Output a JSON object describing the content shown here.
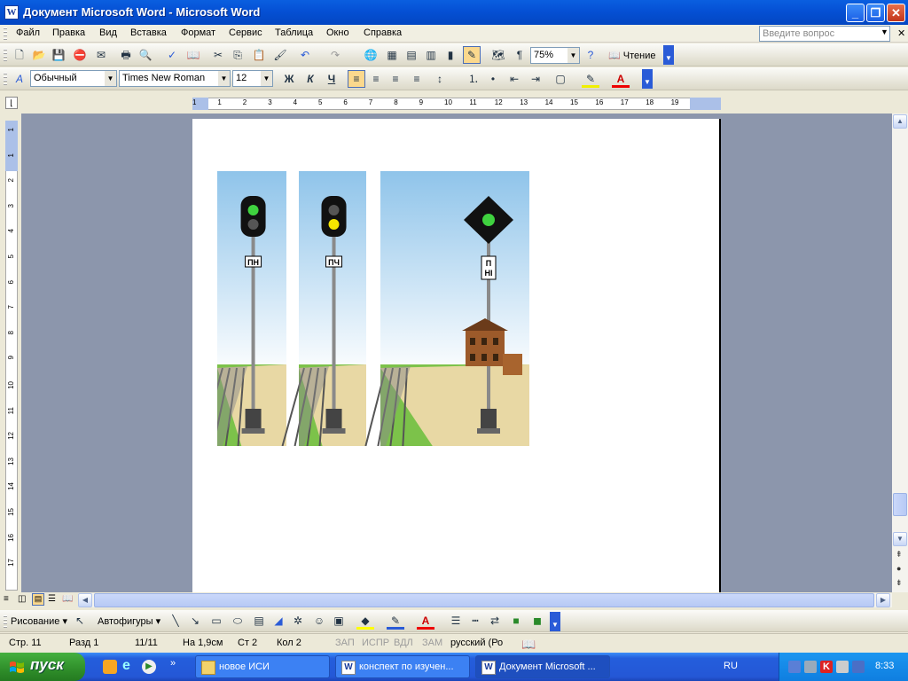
{
  "window": {
    "title": "Документ Microsoft Word - Microsoft Word",
    "icon": "word-icon"
  },
  "menu": {
    "items": [
      "Файл",
      "Правка",
      "Вид",
      "Вставка",
      "Формат",
      "Сервис",
      "Таблица",
      "Окно",
      "Справка"
    ],
    "ask_placeholder": "Введите вопрос"
  },
  "standard_toolbar": {
    "zoom": "75%",
    "reading_label": "Чтение"
  },
  "format_toolbar": {
    "style": "Обычный",
    "font": "Times New Roman",
    "size": "12",
    "bold": "Ж",
    "italic": "К",
    "underline": "Ч"
  },
  "ruler": {
    "h_numbers": [
      "1",
      "1",
      "2",
      "3",
      "4",
      "5",
      "6",
      "7",
      "8",
      "9",
      "10",
      "11",
      "12",
      "13",
      "14",
      "15",
      "16",
      "17",
      "18",
      "19"
    ],
    "v_numbers": [
      "1",
      "1",
      "2",
      "3",
      "4",
      "5",
      "6",
      "7",
      "8",
      "9",
      "10",
      "11",
      "12",
      "13",
      "14",
      "15",
      "16",
      "17"
    ]
  },
  "document": {
    "signals": [
      {
        "label": "ПН",
        "lights": [
          "#3fd23f",
          "#555555"
        ],
        "scene": "tracks"
      },
      {
        "label": "ПЧ",
        "lights": [
          "#555555",
          "#f5e600"
        ],
        "scene": "tracks"
      },
      {
        "label": "П НI",
        "label_lines": [
          "П",
          "НI"
        ],
        "lights": [
          "#3fd23f"
        ],
        "scene": "station"
      }
    ]
  },
  "draw_toolbar": {
    "draw_label": "Рисование",
    "autoshapes_label": "Автофигуры"
  },
  "status": {
    "page": "Стр. 11",
    "section": "Разд 1",
    "pages": "11/11",
    "at": "На 1,9см",
    "line": "Ст 2",
    "col": "Кол 2",
    "rec": "ЗАП",
    "trk": "ИСПР",
    "ext": "ВДЛ",
    "ovr": "ЗАМ",
    "lang": "русский (Ро"
  },
  "taskbar": {
    "start": "пуск",
    "tasks": [
      "новое ИСИ",
      "конспект по изучен...",
      "Документ Microsoft ..."
    ],
    "lang": "RU",
    "time": "8:33"
  }
}
